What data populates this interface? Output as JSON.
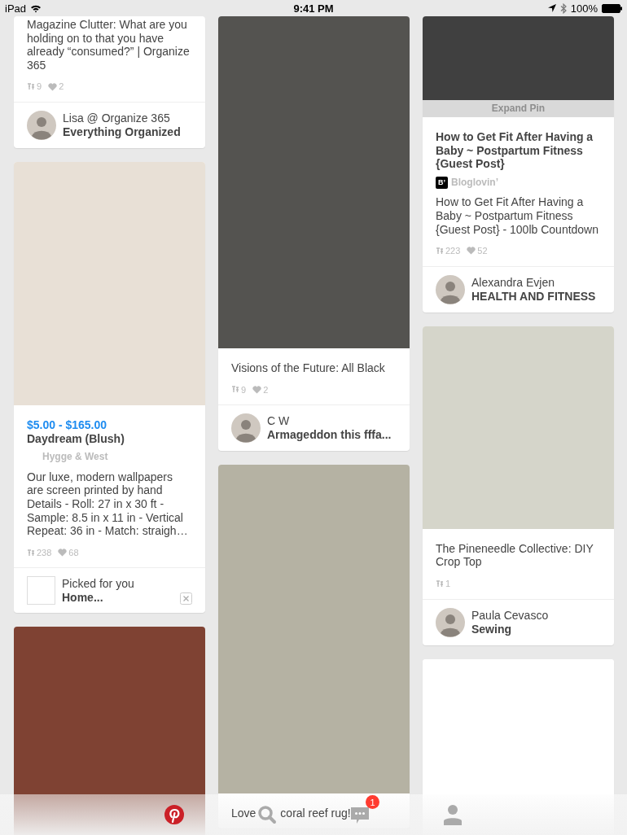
{
  "status_bar": {
    "device": "iPad",
    "time": "9:41 PM",
    "battery": "100%"
  },
  "columns": [
    {
      "cards": [
        {
          "description": "Magazine Clutter: What are you holding on to that you have already “consumed?” | Organize 365",
          "stats": {
            "repins": "9",
            "likes": "2"
          },
          "pinner": {
            "kind": "user",
            "name": "Lisa @ Organize 365",
            "board": "Everything Organized"
          }
        },
        {
          "image": {
            "color": "#e8e0d6"
          },
          "price": "$5.00 - $165.00",
          "title": "Daydream (Blush)",
          "source": {
            "name": "Hygge & West"
          },
          "description": "Our luxe, modern wallpapers are screen printed by hand Details - Roll: 27 in x 30 ft - Sample: 8.5 in x 11 in - Vertical Repeat: 36 in - Match: straigh…",
          "stats": {
            "repins": "238",
            "likes": "68"
          },
          "pinner": {
            "kind": "board",
            "name": "Picked for you",
            "board": "Home...",
            "dismissable": true
          }
        },
        {
          "image": {
            "color": "#7f4233"
          }
        }
      ]
    },
    {
      "cards": [
        {
          "image": {
            "color": "#545350"
          },
          "description": "Visions of the Future: All Black",
          "stats": {
            "repins": "9",
            "likes": "2"
          },
          "pinner": {
            "kind": "user",
            "name": "C W",
            "board": "Armageddon this fffa..."
          }
        },
        {
          "image": {
            "color": "#b5b2a3"
          },
          "description": "Love",
          "description_after": "coral reef rug!"
        }
      ]
    },
    {
      "cards": [
        {
          "image": {
            "color": "#404040"
          },
          "expand_label": "Expand Pin",
          "title": "How to Get Fit After Having a Baby ~ Postpartum Fitness {Guest Post}",
          "source": {
            "name": "Bloglovin’",
            "logo": "B’"
          },
          "description": "How to Get Fit After Having a Baby ~ Postpartum Fitness {Guest Post} - 100lb Countdown",
          "stats": {
            "repins": "223",
            "likes": "52"
          },
          "pinner": {
            "kind": "user",
            "name": "Alexandra Evjen",
            "board": "HEALTH AND FITNESS"
          }
        },
        {
          "image": {
            "color": "#d5d5ca"
          },
          "description": "The Pineneedle Collective: DIY Crop Top",
          "stats": {
            "repins": "1"
          },
          "pinner": {
            "kind": "user",
            "name": "Paula Cevasco",
            "board": "Sewing"
          }
        },
        {
          "image": {
            "color": "#ffffff"
          }
        }
      ]
    }
  ],
  "tab_bar": [
    {
      "kind": "home",
      "selected": true
    },
    {
      "kind": "search",
      "selected": false
    },
    {
      "kind": "messages",
      "selected": false,
      "badge": "1"
    },
    {
      "kind": "profile",
      "selected": false
    }
  ]
}
